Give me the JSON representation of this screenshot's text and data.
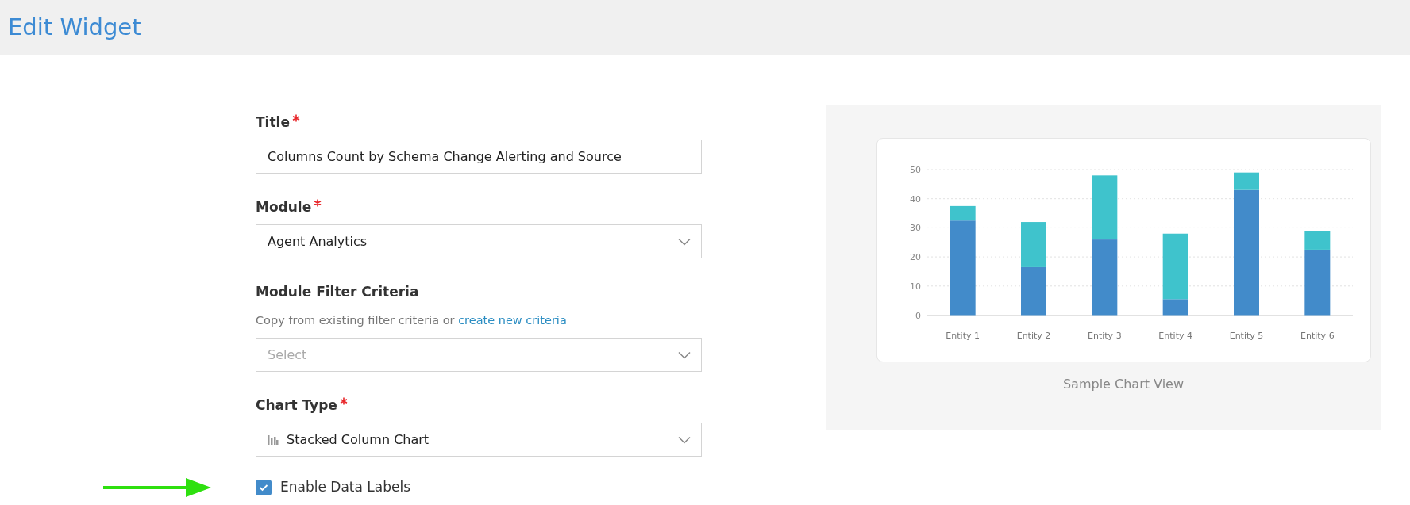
{
  "header": {
    "title": "Edit Widget"
  },
  "fields": [
    {
      "kind": "text",
      "label": "Title",
      "required": true,
      "value": "Columns Count by Schema Change Alerting and Source"
    },
    {
      "kind": "select",
      "label": "Module",
      "required": true,
      "value": "Agent Analytics"
    },
    {
      "kind": "select",
      "label": "Module Filter Criteria",
      "required": false,
      "hint": "Copy from existing filter criteria or",
      "hint_link": "create new criteria",
      "placeholder": "Select"
    },
    {
      "kind": "icon-select",
      "label": "Chart Type",
      "required": true,
      "value": "Stacked Column Chart"
    }
  ],
  "data_labels_option": {
    "label": "Enable Data Labels",
    "checked": true
  },
  "preview": {
    "caption": "Sample Chart View",
    "chart_data": {
      "type": "bar",
      "stacked": true,
      "grid": true,
      "orientation": "vertical",
      "categories": [
        "Entity 1",
        "Entity 2",
        "Entity 3",
        "Entity 4",
        "Entity 5",
        "Entity 6"
      ],
      "ylim": [
        0,
        50
      ],
      "yticks": [
        0,
        10,
        20,
        30,
        40,
        50
      ],
      "series": [
        {
          "color": "#428bca",
          "values": [
            32.5,
            16.5,
            26,
            5.5,
            43,
            22.5
          ]
        },
        {
          "color": "#3fc3cc",
          "values": [
            5,
            15.5,
            22,
            22.5,
            6,
            6.5
          ]
        }
      ]
    }
  }
}
